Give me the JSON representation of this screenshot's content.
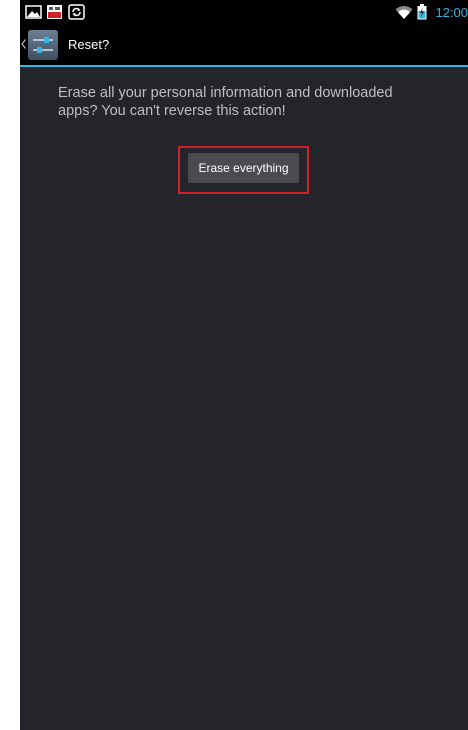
{
  "status_bar": {
    "time": "12:00",
    "icons": [
      "picture-icon",
      "app-badge-icon",
      "sync-icon",
      "wifi-icon",
      "battery-icon"
    ]
  },
  "action_bar": {
    "title": "Reset?",
    "icon": "settings-sliders-icon"
  },
  "content": {
    "message": "Erase all your personal information and downloaded apps? You can't reverse this action!",
    "erase_button_label": "Erase everything"
  },
  "colors": {
    "accent": "#33b5e5",
    "background": "#24252a",
    "highlight": "#d0202a",
    "button": "#4b4b4f"
  }
}
